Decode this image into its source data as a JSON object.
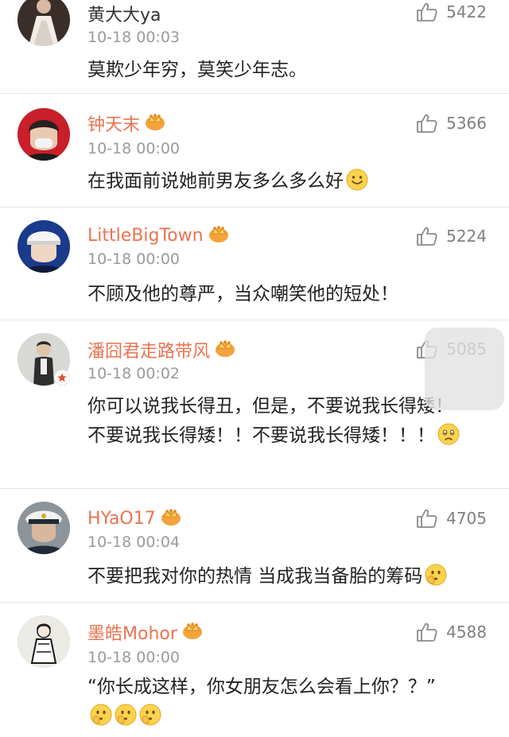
{
  "colors": {
    "vip_name": "#eb7350",
    "normal_name": "#333333",
    "meta": "#9a9a9a",
    "like": "#808080",
    "divider": "#e6e6e6"
  },
  "comments": [
    {
      "username": "黄大大ya",
      "vip": false,
      "time": "10-18 00:03",
      "likes": "5422",
      "text": "莫欺少年穷，莫笑少年志。",
      "avatar": "avatar-wedding-dress",
      "emojis": []
    },
    {
      "username": "钟天末",
      "vip": true,
      "time": "10-18 00:00",
      "likes": "5366",
      "text": "在我面前说她前男友多么多么好",
      "avatar": "avatar-masked-man",
      "emojis": [
        "smile-emoji"
      ]
    },
    {
      "username": "LittleBigTown",
      "vip": true,
      "time": "10-18 00:00",
      "likes": "5224",
      "text": "不顾及他的尊严，当众嘲笑他的短处！",
      "avatar": "avatar-cap-boy",
      "emojis": []
    },
    {
      "username": "潘囧君走路带风",
      "vip": true,
      "time": "10-18 00:02",
      "likes": "5085",
      "text": "你可以说我长得丑，但是，不要说我长得矮！不要说我长得矮！！不要说我长得矮！！！",
      "avatar": "avatar-man-standing",
      "emojis": [
        "sad-emoji"
      ]
    },
    {
      "username": "HYaO17",
      "vip": true,
      "time": "10-18 00:04",
      "likes": "4705",
      "text": "不要把我对你的热情 当成我当备胎的筹码",
      "avatar": "avatar-officer",
      "emojis": [
        "thinking-emoji"
      ]
    },
    {
      "username": "墨皓Mohor",
      "vip": true,
      "time": "10-18 00:00",
      "likes": "4588",
      "text": "“你长成这样，你女朋友怎么会看上你？？”",
      "avatar": "avatar-illustration",
      "emojis": [
        "thinking-emoji",
        "thinking-emoji",
        "thinking-emoji"
      ]
    }
  ]
}
